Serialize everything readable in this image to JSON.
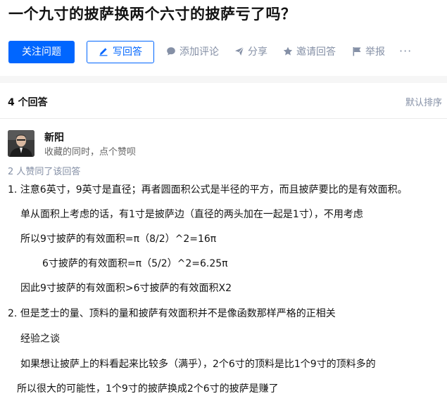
{
  "question": {
    "title": "一个九寸的披萨换两个六寸的披萨亏了吗？"
  },
  "actions": {
    "follow_label": "关注问题",
    "write_label": "写回答",
    "comment_label": "添加评论",
    "share_label": "分享",
    "invite_label": "邀请回答",
    "report_label": "举报",
    "more_label": "···"
  },
  "answers_header": {
    "count_label": "4 个回答",
    "sort_label": "默认排序"
  },
  "answer": {
    "author_name": "新阳",
    "author_bio": "收藏的同时，点个赞呗",
    "vote_text": "2 人赞同了该回答",
    "lines": [
      "1. 注意6英寸，9英寸是直径；再者圆面积公式是半径的平方，而且披萨要比的是有效面积。",
      "单从面积上考虑的话，有1寸是披萨边（直径的两头加在一起是1寸），不用考虑",
      "所以9寸披萨的有效面积=π（8/2）^2=16π",
      "6寸披萨的有效面积=π（5/2）^2=6.25π",
      "因此9寸披萨的有效面积>6寸披萨的有效面积X2",
      "2. 但是芝士的量、顶料的量和披萨有效面积并不是像函数那样严格的正相关",
      "经验之谈",
      "如果想让披萨上的料看起来比较多（满乎），2个6寸的顶料是比1个9寸的顶料多的",
      "所以很大的可能性，1个9寸的披萨换成2个6寸的披萨是赚了"
    ]
  },
  "colors": {
    "primary": "#0066ff",
    "muted": "#8590a6",
    "text": "#121212",
    "background": "#f6f6f6"
  },
  "icons": [
    "pencil-icon",
    "comment-icon",
    "share-icon",
    "star-icon",
    "flag-icon",
    "more-icon"
  ]
}
